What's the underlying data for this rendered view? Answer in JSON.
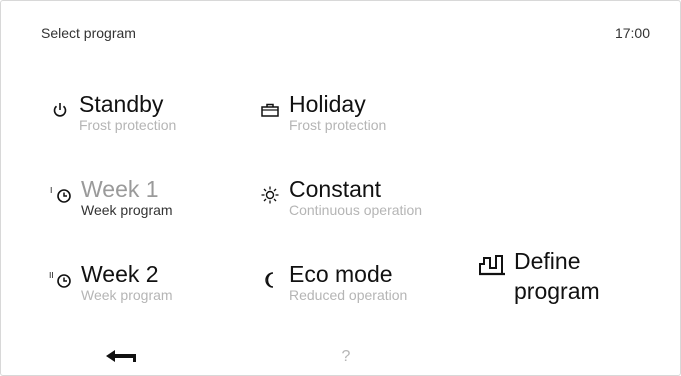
{
  "header": {
    "title": "Select program",
    "time": "17:00"
  },
  "programs": {
    "standby": {
      "label": "Standby",
      "sub": "Frost protection"
    },
    "holiday": {
      "label": "Holiday",
      "sub": "Frost protection"
    },
    "week1": {
      "label": "Week 1",
      "sub": "Week program",
      "badge": "I"
    },
    "constant": {
      "label": "Constant",
      "sub": "Continuous operation"
    },
    "week2": {
      "label": "Week 2",
      "sub": "Week program",
      "badge": "II"
    },
    "eco": {
      "label": "Eco mode",
      "sub": "Reduced operation"
    },
    "define": {
      "line1": "Define",
      "line2": "program"
    }
  },
  "footer": {
    "help": "?"
  },
  "icons": {
    "standby": "power-icon",
    "holiday": "suitcase-icon",
    "week1": "clock-icon",
    "constant": "sun-icon",
    "week2": "clock-icon",
    "eco": "moon-icon",
    "define": "program-graph-icon",
    "back": "back-arrow-icon"
  }
}
